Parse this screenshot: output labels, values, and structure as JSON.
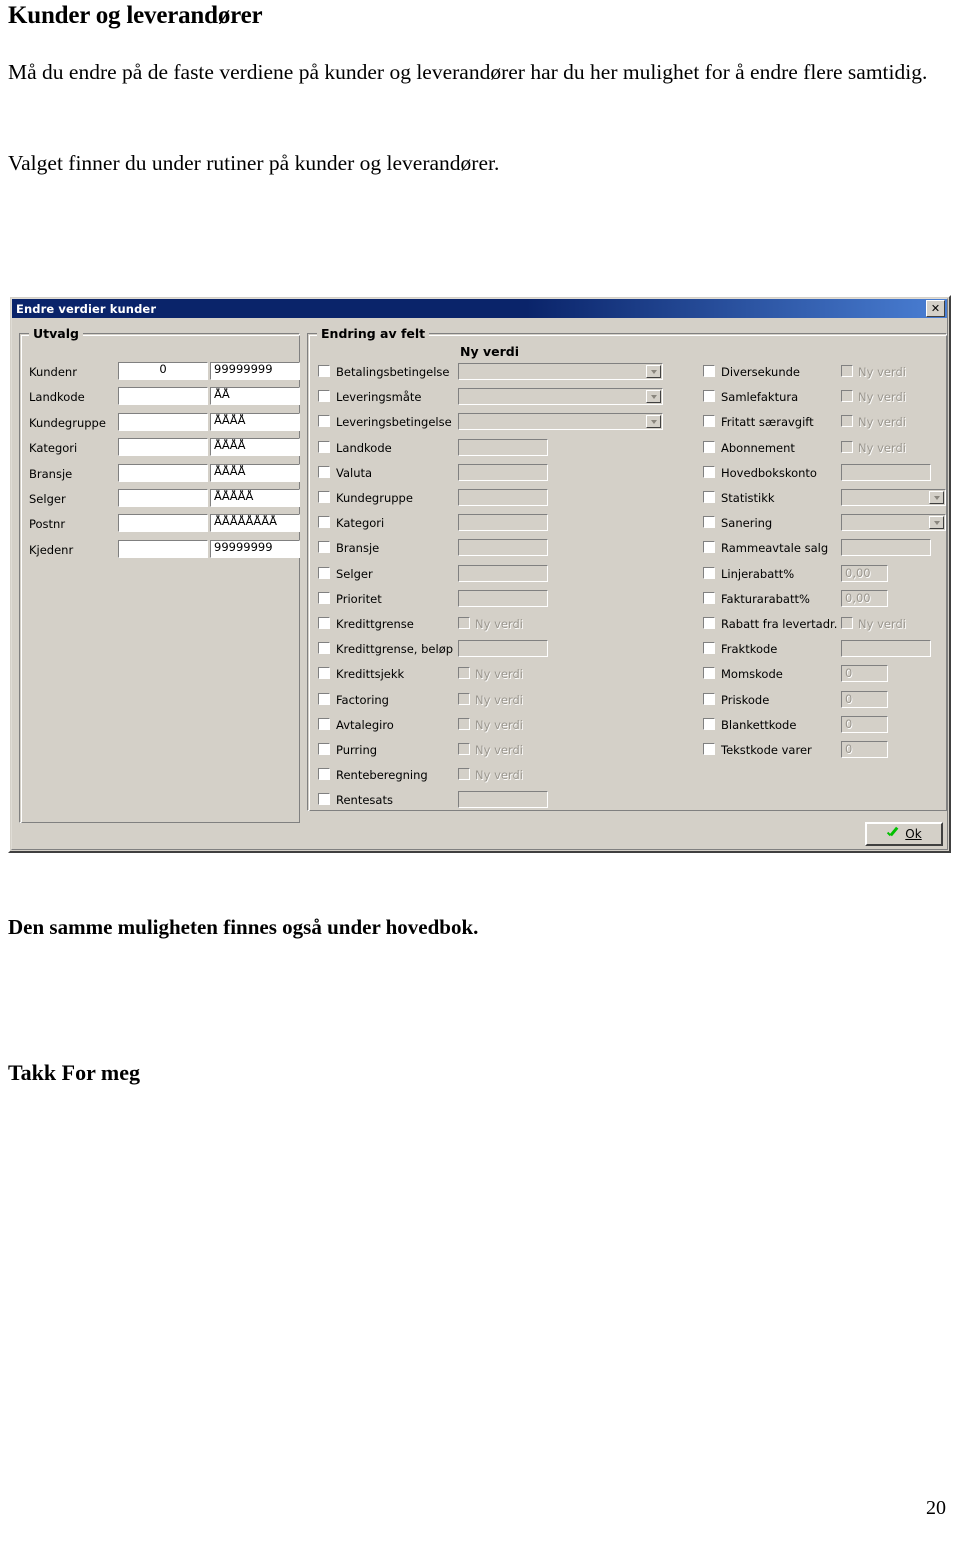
{
  "document": {
    "title": "Kunder og leverandører",
    "paragraph1": "Må du endre på de faste verdiene på kunder og leverandører har du her mulighet for å endre flere samtidig.",
    "paragraph2": "Valget finner du under rutiner på kunder og leverandører.",
    "paragraph3": "Den samme muligheten finnes også under hovedbok.",
    "paragraph4": "Takk For meg",
    "page_number": "20"
  },
  "dialog": {
    "title": "Endre verdier kunder",
    "close_label": "✕",
    "ok_label": "Ok",
    "ok_icon": "green-check-icon",
    "groups": {
      "utvalg": {
        "title": "Utvalg"
      },
      "endring": {
        "title": "Endring av felt",
        "new_value_header": "Ny verdi"
      }
    },
    "utvalg_rows": [
      {
        "label": "Kundenr",
        "from": "0",
        "to": "99999999"
      },
      {
        "label": "Landkode",
        "from": "",
        "to": "ÅÅ"
      },
      {
        "label": "Kundegruppe",
        "from": "",
        "to": "ÅÅÅÅ"
      },
      {
        "label": "Kategori",
        "from": "",
        "to": "ÅÅÅÅ"
      },
      {
        "label": "Bransje",
        "from": "",
        "to": "ÅÅÅÅ"
      },
      {
        "label": "Selger",
        "from": "",
        "to": "ÅÅÅÅÅ"
      },
      {
        "label": "Postnr",
        "from": "",
        "to": "ÅÅÅÅÅÅÅÅ"
      },
      {
        "label": "Kjedenr",
        "from": "",
        "to": "99999999"
      }
    ],
    "field_rows_left": [
      {
        "label": "Betalingsbetingelse",
        "checked": false,
        "control": "combo",
        "value": ""
      },
      {
        "label": "Leveringsmåte",
        "checked": false,
        "control": "combo",
        "value": ""
      },
      {
        "label": "Leveringsbetingelse",
        "checked": false,
        "control": "combo",
        "value": ""
      },
      {
        "label": "Landkode",
        "checked": false,
        "control": "text",
        "value": ""
      },
      {
        "label": "Valuta",
        "checked": false,
        "control": "text",
        "value": ""
      },
      {
        "label": "Kundegruppe",
        "checked": false,
        "control": "text",
        "value": ""
      },
      {
        "label": "Kategori",
        "checked": false,
        "control": "text",
        "value": ""
      },
      {
        "label": "Bransje",
        "checked": false,
        "control": "text",
        "value": ""
      },
      {
        "label": "Selger",
        "checked": false,
        "control": "text",
        "value": ""
      },
      {
        "label": "Prioritet",
        "checked": false,
        "control": "text",
        "value": ""
      },
      {
        "label": "Kredittgrense",
        "checked": false,
        "control": "checkbox",
        "value": "Ny verdi"
      },
      {
        "label": "Kredittgrense, beløp",
        "checked": false,
        "control": "text",
        "value": ""
      },
      {
        "label": "Kredittsjekk",
        "checked": false,
        "control": "checkbox",
        "value": "Ny verdi"
      },
      {
        "label": "Factoring",
        "checked": false,
        "control": "checkbox",
        "value": "Ny verdi"
      },
      {
        "label": "Avtalegiro",
        "checked": false,
        "control": "checkbox",
        "value": "Ny verdi"
      },
      {
        "label": "Purring",
        "checked": false,
        "control": "checkbox",
        "value": "Ny verdi"
      },
      {
        "label": "Renteberegning",
        "checked": false,
        "control": "checkbox",
        "value": "Ny verdi"
      },
      {
        "label": "Rentesats",
        "checked": false,
        "control": "text",
        "value": ""
      }
    ],
    "field_rows_right": [
      {
        "label": "Diversekunde",
        "checked": false,
        "control": "checkbox",
        "value": "Ny verdi"
      },
      {
        "label": "Samlefaktura",
        "checked": false,
        "control": "checkbox",
        "value": "Ny verdi"
      },
      {
        "label": "Fritatt særavgift",
        "checked": false,
        "control": "checkbox",
        "value": "Ny verdi"
      },
      {
        "label": "Abonnement",
        "checked": false,
        "control": "checkbox",
        "value": "Ny verdi"
      },
      {
        "label": "Hovedbokskonto",
        "checked": false,
        "control": "text",
        "value": ""
      },
      {
        "label": "Statistikk",
        "checked": false,
        "control": "combo",
        "value": ""
      },
      {
        "label": "Sanering",
        "checked": false,
        "control": "combo",
        "value": ""
      },
      {
        "label": "Rammeavtale salg",
        "checked": false,
        "control": "text",
        "value": ""
      },
      {
        "label": "Linjerabatt%",
        "checked": false,
        "control": "small",
        "value": "0,00"
      },
      {
        "label": "Fakturarabatt%",
        "checked": false,
        "control": "small",
        "value": "0,00"
      },
      {
        "label": "Rabatt fra levertadr.",
        "checked": false,
        "control": "checkbox",
        "value": "Ny verdi"
      },
      {
        "label": "Fraktkode",
        "checked": false,
        "control": "text",
        "value": ""
      },
      {
        "label": "Momskode",
        "checked": false,
        "control": "small",
        "value": "0"
      },
      {
        "label": "Priskode",
        "checked": false,
        "control": "small",
        "value": "0"
      },
      {
        "label": "Blankettkode",
        "checked": false,
        "control": "small",
        "value": "0"
      },
      {
        "label": "Tekstkode varer",
        "checked": false,
        "control": "small",
        "value": "0"
      }
    ]
  },
  "colors": {
    "dialog_face": "#d4d0c8",
    "titlebar_start": "#0a246a",
    "titlebar_end": "#4a7fd4",
    "disabled_text": "#9a968e",
    "check_green": "#00c000"
  }
}
